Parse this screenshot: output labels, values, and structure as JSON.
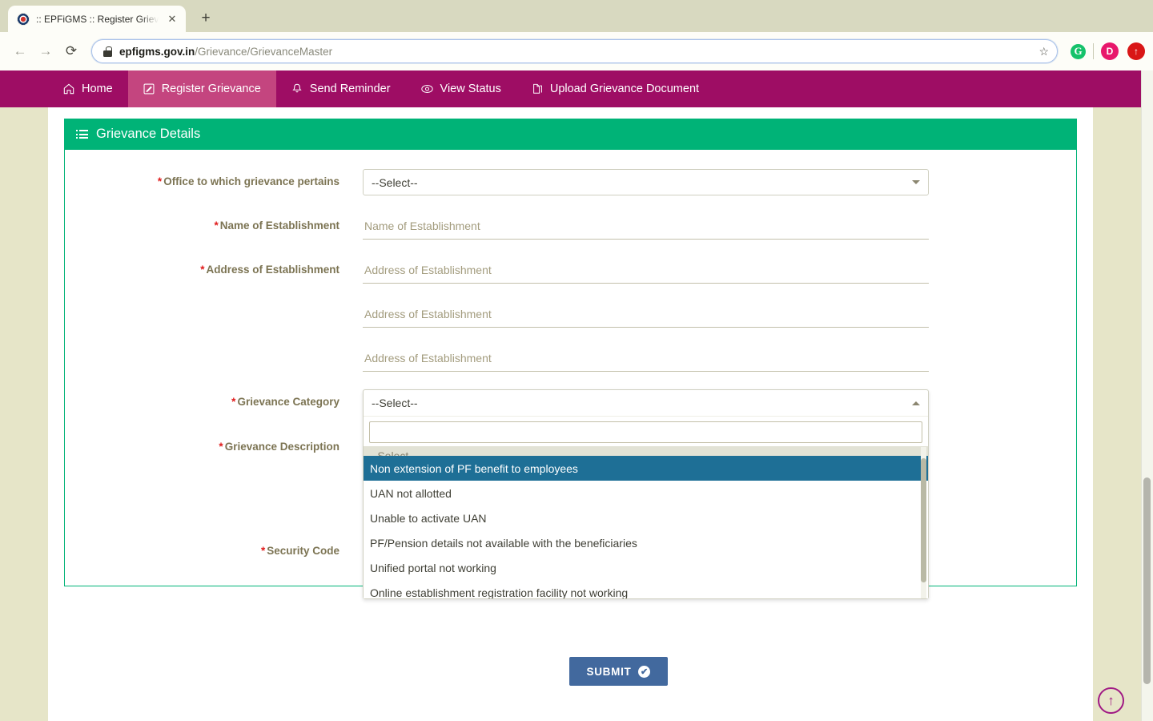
{
  "browser": {
    "tab": {
      "title": ":: EPFiGMS :: Register Grievanc",
      "close_label": "✕",
      "favicon": "epfo-emblem-icon"
    },
    "newtab_label": "+",
    "nav": {
      "back": "←",
      "forward": "→",
      "reload": "⟳"
    },
    "address": {
      "domain": "epfigms.gov.in",
      "path": "/Grievance/GrievanceMaster",
      "lock": "lock-icon"
    },
    "star_label": "☆",
    "extensions": [
      {
        "name": "grammarly-extension",
        "label": "G"
      },
      {
        "name": "profile-avatar",
        "label": "D"
      },
      {
        "name": "update-browser-button",
        "label": "↑"
      }
    ]
  },
  "navbar": {
    "items": [
      {
        "label": "Home",
        "icon": "home-icon",
        "glyph": "⌂",
        "active": false
      },
      {
        "label": "Register Grievance",
        "icon": "edit-icon",
        "glyph": "✎",
        "active": true
      },
      {
        "label": "Send Reminder",
        "icon": "bell-icon",
        "glyph": "🔔",
        "active": false
      },
      {
        "label": "View Status",
        "icon": "eye-icon",
        "glyph": "◎",
        "active": false
      },
      {
        "label": "Upload Grievance Document",
        "icon": "document-icon",
        "glyph": "🗐",
        "active": false
      }
    ]
  },
  "card": {
    "title": "Grievance Details",
    "header_icon": "list-icon",
    "accent_color": "#00b377"
  },
  "form": {
    "office": {
      "label": "Office to which grievance pertains",
      "required": "*",
      "value": "--Select--",
      "caret": "chevron-down-icon"
    },
    "name_of_establishment": {
      "label": "Name of Establishment",
      "required": "*",
      "placeholder": "Name of Establishment",
      "value": ""
    },
    "address_of_establishment": {
      "label": "Address of Establishment",
      "required": "*",
      "lines": [
        {
          "placeholder": "Address of Establishment",
          "value": ""
        },
        {
          "placeholder": "Address of Establishment",
          "value": ""
        },
        {
          "placeholder": "Address of Establishment",
          "value": ""
        }
      ]
    },
    "grievance_category": {
      "label": "Grievance Category",
      "required": "*",
      "value": "--Select--",
      "caret": "chevron-up-icon",
      "open": true,
      "search_value": "",
      "search_placeholder": "",
      "clipped_option": "--Select--",
      "options": [
        "Non extension of PF benefit to employees",
        "UAN not allotted",
        "Unable to activate UAN",
        "PF/Pension details not available with the beneficiaries",
        "Unified portal not working",
        "Online establishment registration facility not working"
      ],
      "selected_index": 0,
      "highlight_color": "#1e6f96"
    },
    "grievance_description": {
      "label": "Grievance Description",
      "required": "*",
      "value": ""
    },
    "security_code": {
      "label": "Security Code",
      "required": "*",
      "value": ""
    }
  },
  "submit": {
    "label": "SUBMIT",
    "icon": "check-circle-icon",
    "glyph": "✔",
    "color": "#42699e"
  },
  "scroll_to_top": {
    "icon": "arrow-up-circle-icon",
    "glyph": "↑",
    "color": "#a01a84"
  }
}
